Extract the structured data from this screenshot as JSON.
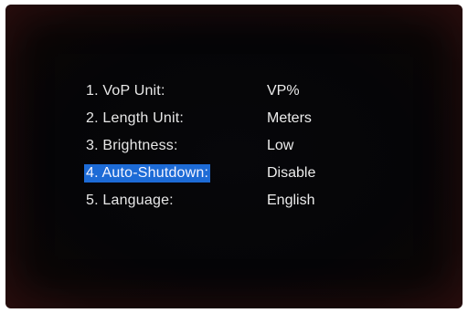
{
  "settings": {
    "items": [
      {
        "label": "1. VoP Unit:",
        "value": "VP%",
        "selected": false
      },
      {
        "label": "2. Length Unit:",
        "value": "Meters",
        "selected": false
      },
      {
        "label": "3. Brightness:",
        "value": "Low",
        "selected": false
      },
      {
        "label": "4. Auto-Shutdown:",
        "value": "Disable",
        "selected": true
      },
      {
        "label": "5. Language:",
        "value": "English",
        "selected": false
      }
    ]
  },
  "colors": {
    "background": "#050507",
    "text": "#e8e8e8",
    "highlight": "#1d6bd6"
  }
}
